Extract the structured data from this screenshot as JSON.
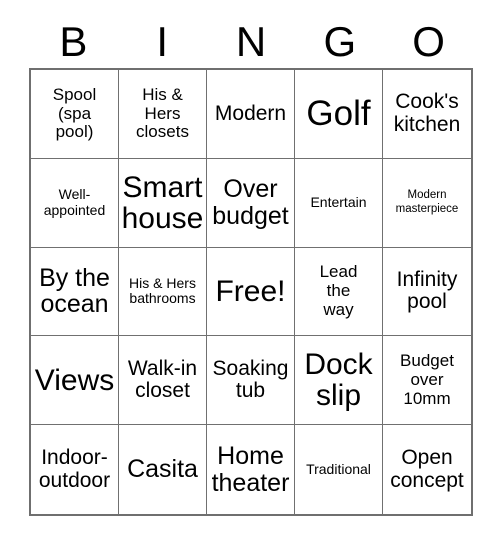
{
  "card": {
    "title": "BINGO",
    "header_letters": [
      "B",
      "I",
      "N",
      "G",
      "O"
    ],
    "grid_size": "5x5",
    "colors": {
      "text": "#000000",
      "background": "#ffffff",
      "grid_line": "#707070",
      "grid_border": "#6f6f6f"
    },
    "rows": [
      [
        {
          "text": "Spool\n(spa\npool)",
          "size": "sz-m"
        },
        {
          "text": "His &\nHers\nclosets",
          "size": "sz-m"
        },
        {
          "text": "Modern",
          "size": "sz-l"
        },
        {
          "text": "Golf",
          "size": "sz-xxxl"
        },
        {
          "text": "Cook's\nkitchen",
          "size": "sz-l"
        }
      ],
      [
        {
          "text": "Well-\nappointed",
          "size": "sz-s"
        },
        {
          "text": "Smart\nhouse",
          "size": "sz-xxl"
        },
        {
          "text": "Over\nbudget",
          "size": "sz-xl"
        },
        {
          "text": "Entertain",
          "size": "sz-s"
        },
        {
          "text": "Modern\nmasterpiece",
          "size": "sz-xs"
        }
      ],
      [
        {
          "text": "By the\nocean",
          "size": "sz-xl"
        },
        {
          "text": "His & Hers\nbathrooms",
          "size": "sz-s"
        },
        {
          "text": "Free!",
          "size": "sz-xxl"
        },
        {
          "text": "Lead\nthe\nway",
          "size": "sz-m"
        },
        {
          "text": "Infinity\npool",
          "size": "sz-l"
        }
      ],
      [
        {
          "text": "Views",
          "size": "sz-xxl"
        },
        {
          "text": "Walk-in\ncloset",
          "size": "sz-l"
        },
        {
          "text": "Soaking\ntub",
          "size": "sz-l"
        },
        {
          "text": "Dock\nslip",
          "size": "sz-xxl"
        },
        {
          "text": "Budget\nover\n10mm",
          "size": "sz-m"
        }
      ],
      [
        {
          "text": "Indoor-\noutdoor",
          "size": "sz-l"
        },
        {
          "text": "Casita",
          "size": "sz-xl"
        },
        {
          "text": "Home\ntheater",
          "size": "sz-xl"
        },
        {
          "text": "Traditional",
          "size": "sz-s"
        },
        {
          "text": "Open\nconcept",
          "size": "sz-l"
        }
      ]
    ]
  }
}
